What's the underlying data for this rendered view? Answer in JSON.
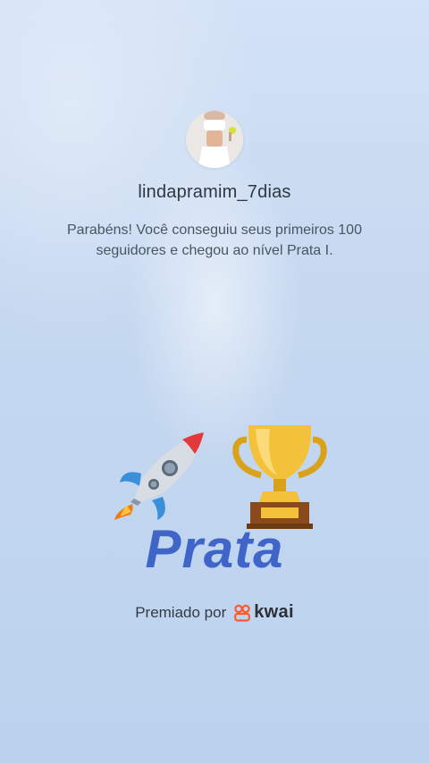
{
  "profile": {
    "username": "lindapramim_7dias",
    "avatar_icon": "profile-photo"
  },
  "message": "Parabéns! Você conseguiu seus primeiros 100 seguidores e chegou ao nível Prata I.",
  "badge": {
    "level_name": "Prata",
    "icons": [
      "rocket-icon",
      "trophy-icon"
    ]
  },
  "footer": {
    "awarded_by_label": "Premiado por",
    "brand_name": "kwai",
    "brand_color": "#ff5a2c"
  },
  "colors": {
    "level_text": "#3f65c8",
    "background": "#c5d8f0"
  }
}
